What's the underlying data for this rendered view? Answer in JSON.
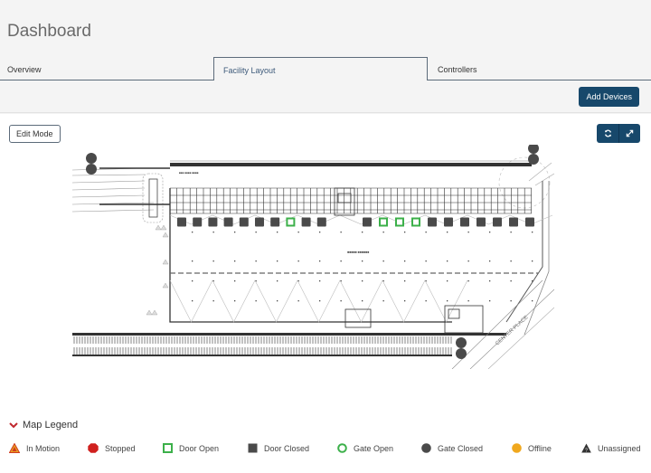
{
  "header": {
    "title": "Dashboard"
  },
  "tabs": [
    {
      "label": "Overview",
      "active": false
    },
    {
      "label": "Facility Layout",
      "active": true
    },
    {
      "label": "Controllers",
      "active": false
    }
  ],
  "toolbar": {
    "add_devices_label": "Add Devices"
  },
  "map_panel": {
    "edit_mode_label": "Edit Mode",
    "icons": [
      "refresh-icon",
      "expand-icon"
    ],
    "doors_north_left": [
      "closed",
      "closed",
      "closed",
      "closed",
      "closed",
      "closed",
      "closed",
      "open",
      "closed",
      "closed"
    ],
    "doors_north_right": [
      "closed",
      "open",
      "open",
      "open",
      "closed",
      "closed",
      "closed",
      "closed",
      "closed",
      "closed",
      "closed"
    ],
    "gates": [
      "closed",
      "closed",
      "closed",
      "closed",
      "closed",
      "closed"
    ]
  },
  "legend": {
    "title": "Map Legend",
    "items": [
      {
        "label": "In Motion",
        "icon": "in-motion-icon",
        "color": "#e8a020"
      },
      {
        "label": "Stopped",
        "icon": "stopped-icon",
        "color": "#d0201e"
      },
      {
        "label": "Door Open",
        "icon": "door-open-icon",
        "color": "#3cb04a"
      },
      {
        "label": "Door Closed",
        "icon": "door-closed-icon",
        "color": "#4a4a4a"
      },
      {
        "label": "Gate Open",
        "icon": "gate-open-icon",
        "color": "#3cb04a"
      },
      {
        "label": "Gate Closed",
        "icon": "gate-closed-icon",
        "color": "#4a4a4a"
      },
      {
        "label": "Offline",
        "icon": "offline-icon",
        "color": "#f0a81e"
      },
      {
        "label": "Unassigned",
        "icon": "unassigned-icon",
        "color": "#333333"
      }
    ]
  },
  "colors": {
    "primary": "#17486b",
    "open": "#3cb04a",
    "closed": "#4a4a4a"
  }
}
